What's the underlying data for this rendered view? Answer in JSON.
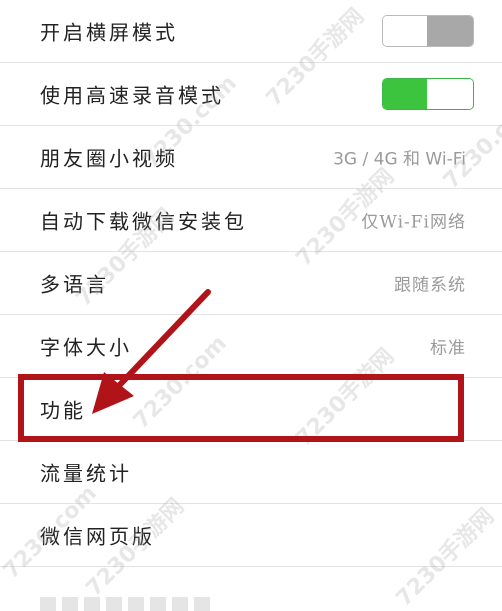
{
  "settings": {
    "rows": [
      {
        "label": "开启横屏模式",
        "type": "toggle",
        "state": "off"
      },
      {
        "label": "使用高速录音模式",
        "type": "toggle",
        "state": "on"
      },
      {
        "label": "朋友圈小视频",
        "type": "value",
        "value": "3G / 4G 和 Wi-Fi"
      },
      {
        "label": "自动下载微信安装包",
        "type": "value",
        "value": "仅Wi-Fi网络"
      },
      {
        "label": "多语言",
        "type": "value",
        "value": "跟随系统"
      },
      {
        "label": "字体大小",
        "type": "value",
        "value": "标准"
      },
      {
        "label": "功能",
        "type": "link"
      },
      {
        "label": "流量统计",
        "type": "link"
      },
      {
        "label": "微信网页版",
        "type": "link"
      }
    ]
  },
  "annotation": {
    "color": "#b01418",
    "highlighted_item": "功能"
  },
  "watermark": {
    "text": "7230手游网",
    "domain": "7230.com"
  },
  "colors": {
    "toggle_on": "#3cc43f",
    "toggle_off_track": "#a8a8a8",
    "secondary_text": "#9a9a9a"
  }
}
